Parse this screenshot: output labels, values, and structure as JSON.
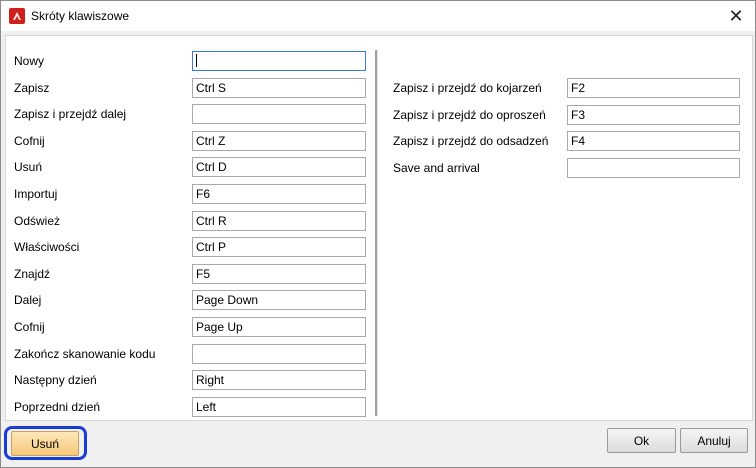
{
  "window": {
    "title": "Skróty klawiszowe",
    "app_icon": "app-logo-icon",
    "close_glyph": "✕"
  },
  "left_rows": [
    {
      "label": "Nowy",
      "value": ""
    },
    {
      "label": "Zapisz",
      "value": "Ctrl S"
    },
    {
      "label": "Zapisz i przejdź dalej",
      "value": ""
    },
    {
      "label": "Cofnij",
      "value": "Ctrl Z"
    },
    {
      "label": "Usuń",
      "value": "Ctrl D"
    },
    {
      "label": "Importuj",
      "value": "F6"
    },
    {
      "label": "Odśwież",
      "value": "Ctrl R"
    },
    {
      "label": "Właściwości",
      "value": "Ctrl P"
    },
    {
      "label": "Znajdź",
      "value": "F5"
    },
    {
      "label": "Dalej",
      "value": "Page Down"
    },
    {
      "label": "Cofnij",
      "value": "Page Up"
    },
    {
      "label": "Zakończ skanowanie kodu",
      "value": ""
    },
    {
      "label": "Następny dzień",
      "value": "Right"
    },
    {
      "label": "Poprzedni dzień",
      "value": "Left"
    }
  ],
  "right_rows": [
    {
      "label": "Zapisz i przejdź do kojarzeń",
      "value": "F2"
    },
    {
      "label": "Zapisz i przejdź do oproszeń",
      "value": "F3"
    },
    {
      "label": "Zapisz i przejdź do odsadzeń",
      "value": "F4"
    },
    {
      "label": "Save and arrival",
      "value": ""
    }
  ],
  "footer": {
    "delete_label": "Usuń",
    "ok_label": "Ok",
    "cancel_label": "Anuluj"
  },
  "colors": {
    "highlight": "#1a3cd6",
    "delete_button": "#f6c87a",
    "focus_border": "#3b78d8"
  }
}
